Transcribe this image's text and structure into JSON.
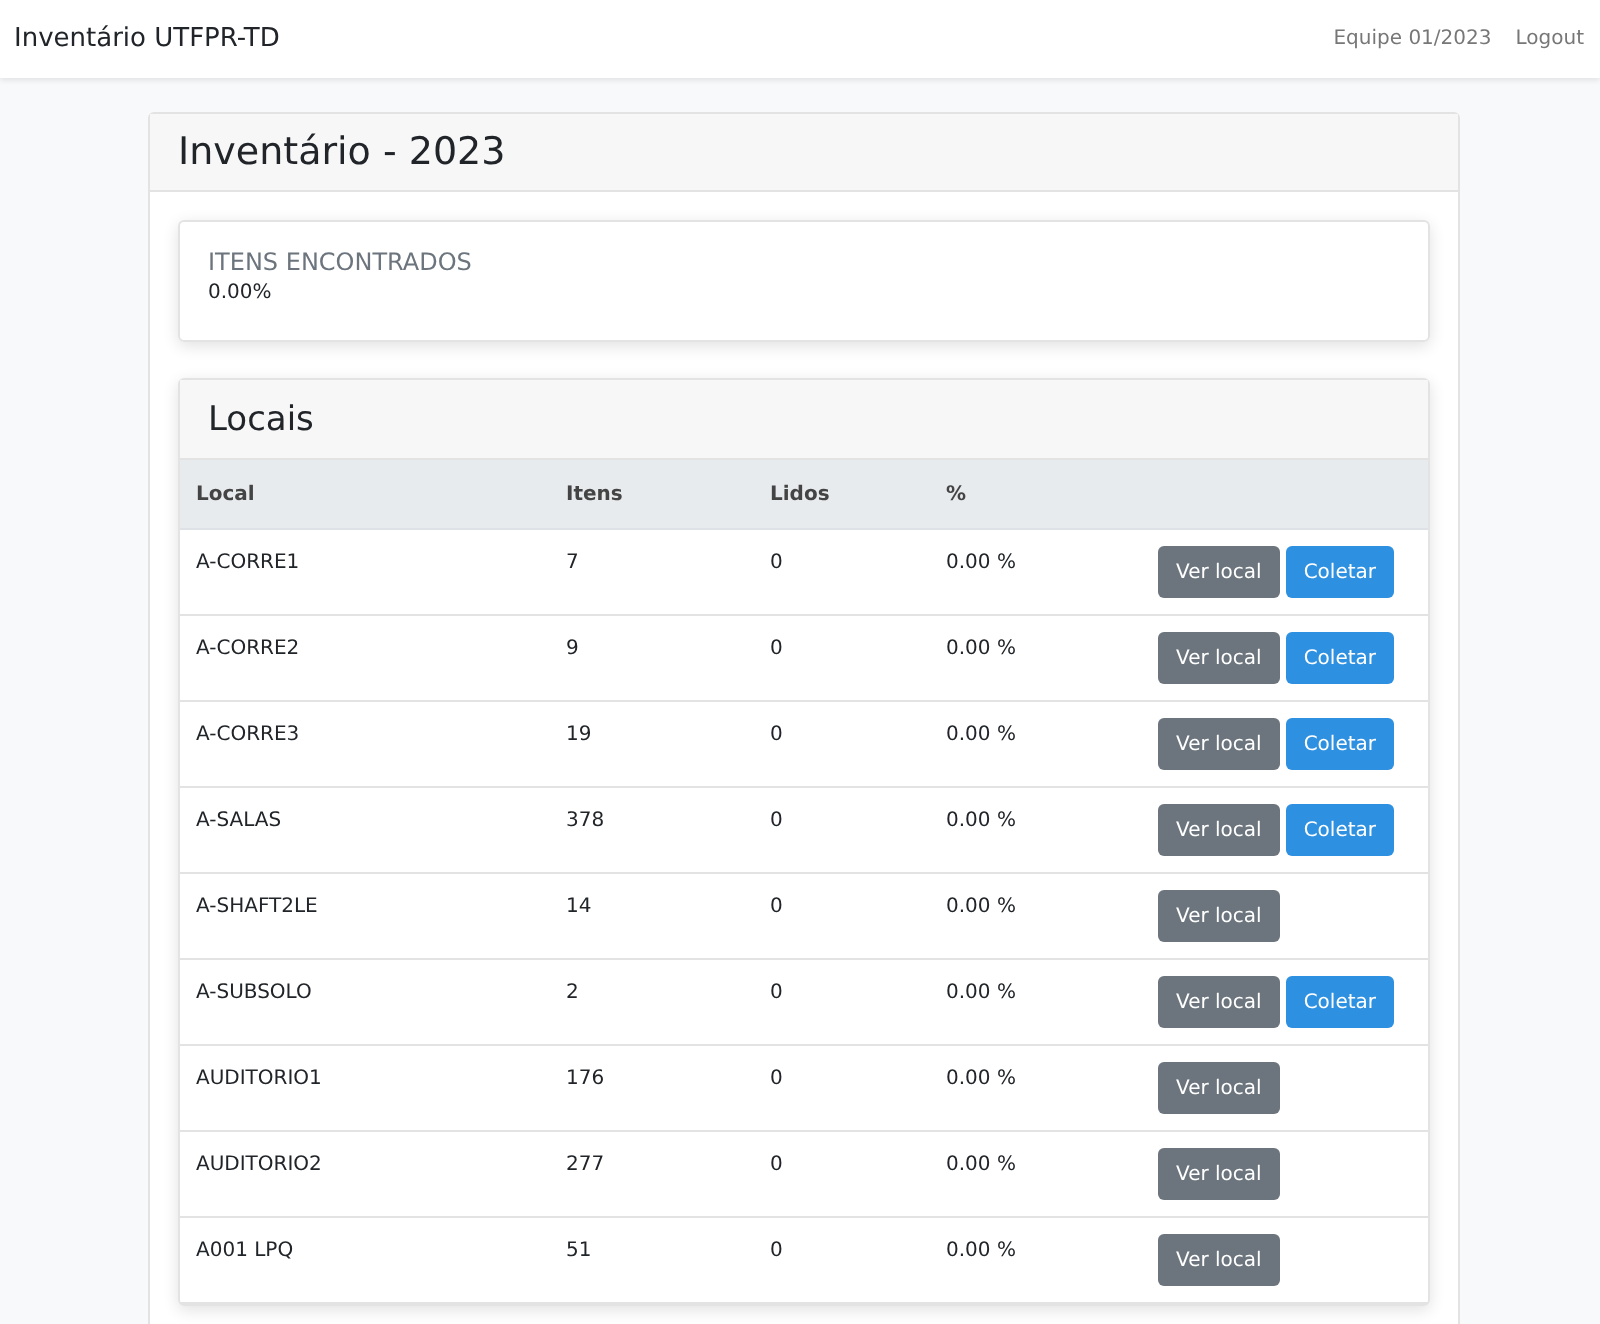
{
  "navbar": {
    "brand": "Inventário UTFPR-TD",
    "links": [
      "Equipe 01/2023",
      "Logout"
    ]
  },
  "page_title": "Inventário - 2023",
  "summary": {
    "label": "ITENS ENCONTRADOS",
    "value": "0.00%"
  },
  "locais": {
    "title": "Locais",
    "columns": [
      "Local",
      "Itens",
      "Lidos",
      "%"
    ],
    "rows": [
      {
        "local": "A-CORRE1",
        "itens": "7",
        "lidos": "0",
        "percent": "0.00 %",
        "buttons": [
          {
            "kind": "secondary",
            "label": "Ver local"
          },
          {
            "kind": "primary",
            "label": "Coletar"
          }
        ]
      },
      {
        "local": "A-CORRE2",
        "itens": "9",
        "lidos": "0",
        "percent": "0.00 %",
        "buttons": [
          {
            "kind": "secondary",
            "label": "Ver local"
          },
          {
            "kind": "primary",
            "label": "Coletar"
          }
        ]
      },
      {
        "local": "A-CORRE3",
        "itens": "19",
        "lidos": "0",
        "percent": "0.00 %",
        "buttons": [
          {
            "kind": "secondary",
            "label": "Ver local"
          },
          {
            "kind": "primary",
            "label": "Coletar"
          }
        ]
      },
      {
        "local": "A-SALAS",
        "itens": "378",
        "lidos": "0",
        "percent": "0.00 %",
        "buttons": [
          {
            "kind": "secondary",
            "label": "Ver local"
          },
          {
            "kind": "primary",
            "label": "Coletar"
          }
        ]
      },
      {
        "local": "A-SHAFT2LE",
        "itens": "14",
        "lidos": "0",
        "percent": "0.00 %",
        "buttons": [
          {
            "kind": "secondary",
            "label": "Ver local"
          }
        ]
      },
      {
        "local": "A-SUBSOLO",
        "itens": "2",
        "lidos": "0",
        "percent": "0.00 %",
        "buttons": [
          {
            "kind": "secondary",
            "label": "Ver local"
          },
          {
            "kind": "primary",
            "label": "Coletar"
          }
        ]
      },
      {
        "local": "AUDITORIO1",
        "itens": "176",
        "lidos": "0",
        "percent": "0.00 %",
        "buttons": [
          {
            "kind": "secondary",
            "label": "Ver local"
          }
        ]
      },
      {
        "local": "AUDITORIO2",
        "itens": "277",
        "lidos": "0",
        "percent": "0.00 %",
        "buttons": [
          {
            "kind": "secondary",
            "label": "Ver local"
          }
        ]
      },
      {
        "local": "A001 LPQ",
        "itens": "51",
        "lidos": "0",
        "percent": "0.00 %",
        "buttons": [
          {
            "kind": "secondary",
            "label": "Ver local"
          }
        ]
      }
    ]
  }
}
